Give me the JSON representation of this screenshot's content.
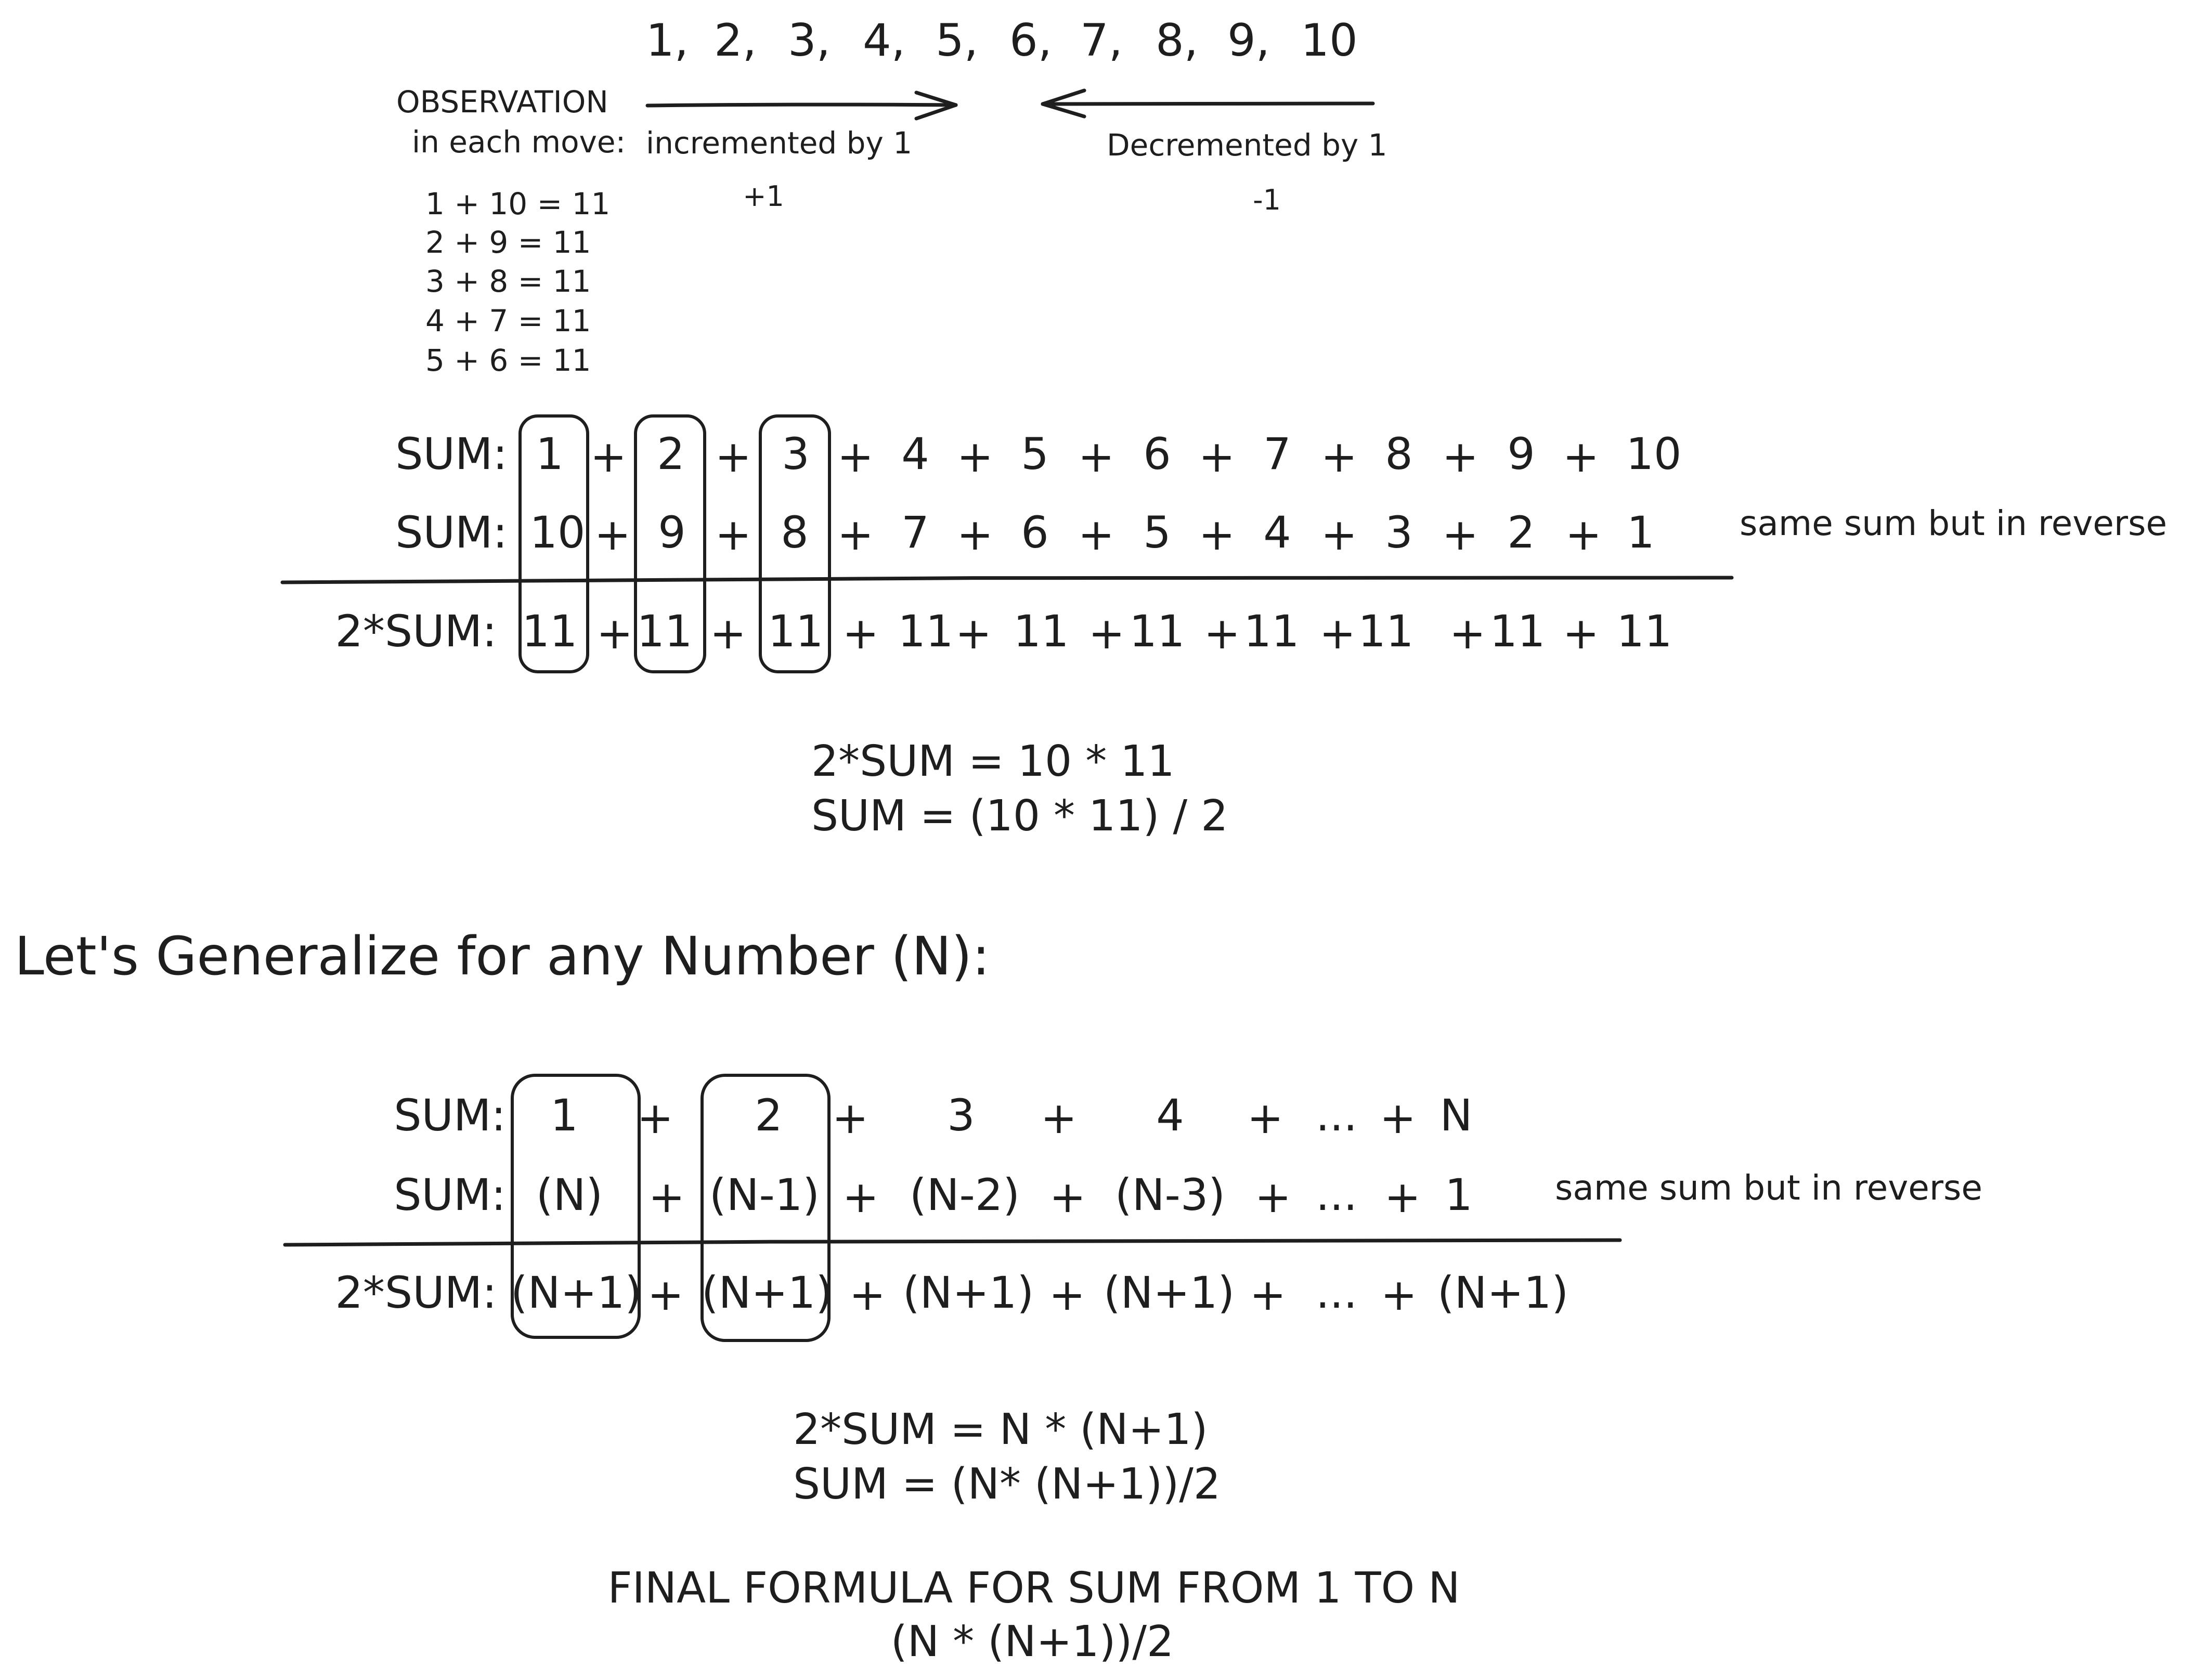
{
  "sequence": [
    "1,",
    "2,",
    "3,",
    "4,",
    "5,",
    "6,",
    "7,",
    "8,",
    "9,",
    "10"
  ],
  "observation": {
    "title": "OBSERVATION",
    "subtitle": "in each move:",
    "inc_label": "incremented by 1",
    "dec_label": "Decremented by 1",
    "inc_sign": "+1",
    "dec_sign": "-1",
    "pairs": [
      "1 + 10 = 11",
      "2 + 9  = 11",
      "3 + 8  = 11",
      "4 + 7  = 11",
      "5 + 6  = 11"
    ]
  },
  "example": {
    "row_labels": [
      "SUM:",
      "SUM:",
      "2*SUM:"
    ],
    "forward": [
      "1",
      "2",
      "3",
      "4",
      "5",
      "6",
      "7",
      "8",
      "9",
      "10"
    ],
    "reverse": [
      "10",
      "9",
      "8",
      "7",
      "6",
      "5",
      "4",
      "3",
      "2",
      "1"
    ],
    "total": [
      "11",
      "11",
      "11",
      "11",
      "11",
      "11",
      "11",
      "11",
      "11",
      "11"
    ],
    "plus": "+",
    "reverse_note": "same sum but in reverse",
    "eq1": "2*SUM = 10 * 11",
    "eq2": "SUM = (10 * 11) / 2"
  },
  "heading": "Let's Generalize for any Number (N):",
  "general": {
    "row_labels": [
      "SUM:",
      "SUM:",
      "2*SUM:"
    ],
    "forward": [
      "1",
      "2",
      "3",
      "4",
      "...",
      "N"
    ],
    "reverse": [
      "(N)",
      "(N-1)",
      "(N-2)",
      "(N-3)",
      "...",
      "1"
    ],
    "total": [
      "(N+1)",
      "(N+1)",
      "(N+1)",
      "(N+1)",
      "...",
      "(N+1)"
    ],
    "plus": "+",
    "reverse_note": "same sum but in reverse",
    "eq1": "2*SUM = N * (N+1)",
    "eq2": "SUM = (N* (N+1))/2",
    "final_title": "FINAL FORMULA FOR SUM FROM 1 TO N",
    "final_formula": "(N * (N+1))/2"
  }
}
